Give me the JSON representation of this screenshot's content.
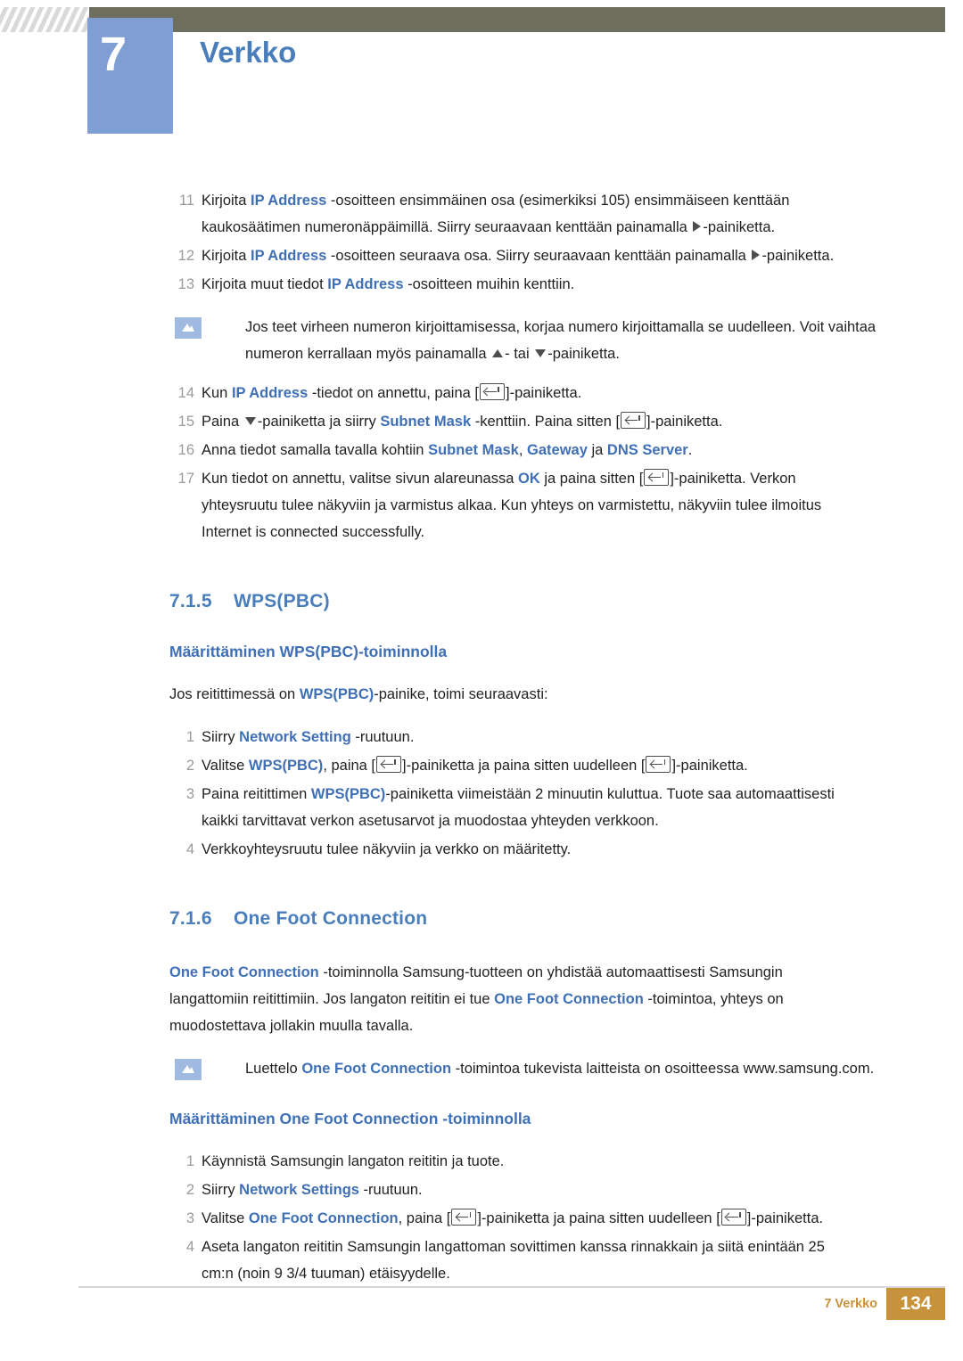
{
  "header": {
    "chapter_number": "7",
    "chapter_title": "Verkko"
  },
  "steps_top": [
    {
      "num": "11",
      "line1_a": "Kirjoita ",
      "line1_kw": "IP Address",
      "line1_b": " -osoitteen ensimmäinen osa (esimerkiksi 105) ensimmäiseen kenttään",
      "line2_a": "kaukosäätimen numeronäppäimillä. Siirry seuraavaan kenttään painamalla ",
      "line2_b": "-painiketta."
    },
    {
      "num": "12",
      "line1_a": "Kirjoita ",
      "line1_kw": "IP Address",
      "line1_b": " -osoitteen seuraava osa. Siirry seuraavaan kenttään painamalla ",
      "line1_c": "-painiketta."
    },
    {
      "num": "13",
      "line1_a": "Kirjoita muut tiedot ",
      "line1_kw": "IP Address",
      "line1_b": " -osoitteen muihin kenttiin."
    }
  ],
  "note1": {
    "line1": "Jos teet virheen numeron kirjoittamisessa, korjaa numero kirjoittamalla se uudelleen. Voit vaihtaa",
    "line2_a": "numeron kerrallaan myös painamalla ",
    "line2_b": "- tai ",
    "line2_c": "-painiketta."
  },
  "steps_mid": [
    {
      "num": "14",
      "a": "Kun ",
      "kw": "IP Address",
      "b": " -tiedot on annettu, paina [",
      "c": "]-painiketta."
    },
    {
      "num": "15",
      "a": "Paina ",
      "b": "-painiketta ja siirry ",
      "kw": "Subnet Mask",
      "c": " -kenttiin. Paina sitten [",
      "d": "]-painiketta."
    },
    {
      "num": "16",
      "a": "Anna tiedot samalla tavalla kohtiin ",
      "kw1": "Subnet Mask",
      "sep1": ", ",
      "kw2": "Gateway",
      "sep2": " ja ",
      "kw3": "DNS Server",
      "b": "."
    },
    {
      "num": "17",
      "a": "Kun tiedot on annettu, valitse sivun alareunassa ",
      "kw": "OK",
      "b": " ja paina sitten [",
      "c": "]-painiketta. Verkon",
      "line2": "yhteysruutu tulee näkyviin ja varmistus alkaa. Kun yhteys on varmistettu, näkyviin tulee ilmoitus",
      "line3": "Internet is connected successfully."
    }
  ],
  "section_wpspbc": {
    "number": "7.1.5",
    "title": "WPS(PBC)",
    "subtitle": "Määrittäminen WPS(PBC)-toiminnolla",
    "intro_a": "Jos reitittimessä on ",
    "intro_kw": "WPS(PBC)",
    "intro_b": "-painike, toimi seuraavasti:",
    "steps": [
      {
        "num": "1",
        "a": "Siirry ",
        "kw": "Network Setting",
        "b": " -ruutuun."
      },
      {
        "num": "2",
        "a": "Valitse ",
        "kw": "WPS(PBC)",
        "b": ", paina [",
        "c": "]-painiketta ja paina sitten uudelleen [",
        "d": "]-painiketta."
      },
      {
        "num": "3",
        "a": "Paina reitittimen ",
        "kw": "WPS(PBC)",
        "b": "-painiketta viimeistään 2 minuutin kuluttua. Tuote saa automaattisesti",
        "line2": "kaikki tarvittavat verkon asetusarvot ja muodostaa yhteyden verkkoon."
      },
      {
        "num": "4",
        "a": "Verkkoyhteysruutu tulee näkyviin ja verkko on määritetty."
      }
    ]
  },
  "section_onefoot": {
    "number": "7.1.6",
    "title": "One Foot Connection",
    "intro_kw1": "One Foot Connection",
    "intro_a": " -toiminnolla Samsung-tuotteen on yhdistää automaattisesti Samsungin",
    "intro_line2_a": "langattomiin reitittimiin. Jos langaton reititin ei tue ",
    "intro_kw2": "One Foot Connection",
    "intro_line2_b": " -toimintoa, yhteys on",
    "intro_line3": "muodostettava jollakin muulla tavalla.",
    "note": {
      "a": "Luettelo ",
      "kw": "One Foot Connection",
      "b": " -toimintoa tukevista laitteista on osoitteessa www.samsung.com."
    },
    "subtitle": "Määrittäminen One Foot Connection -toiminnolla",
    "steps": [
      {
        "num": "1",
        "a": "Käynnistä Samsungin langaton reititin ja tuote."
      },
      {
        "num": "2",
        "a": "Siirry ",
        "kw": "Network Settings",
        "b": " -ruutuun."
      },
      {
        "num": "3",
        "a": "Valitse ",
        "kw": "One Foot Connection",
        "b": ", paina [",
        "c": "]-painiketta ja paina sitten uudelleen [",
        "d": "]-painiketta."
      },
      {
        "num": "4",
        "a": "Aseta langaton reititin Samsungin langattoman sovittimen kanssa rinnakkain ja siitä enintään 25",
        "line2": "cm:n (noin 9 3/4 tuuman) etäisyydelle."
      }
    ]
  },
  "footer": {
    "label": "7 Verkko",
    "page": "134"
  },
  "colors": {
    "accent_blue": "#4a7ebb",
    "keyword_blue": "#3f6fb5",
    "header_bar": "#6e6e5e",
    "number_box": "#7e9ed4",
    "footer_gold": "#c8923a"
  }
}
